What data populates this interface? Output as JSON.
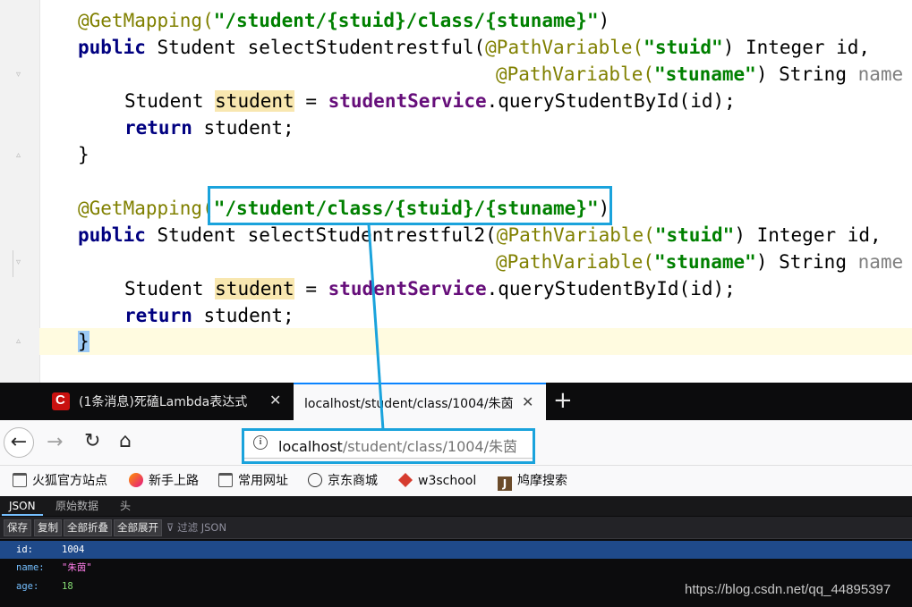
{
  "ide": {
    "l1": {
      "ann": "@GetMapping(",
      "str": "\"/student/{stuid}/class/{stuname}\"",
      "end": ")"
    },
    "l2": {
      "kw": "public",
      "mid": " Student selectStudentrestful(",
      "ann": "@PathVariable(",
      "str": "\"stuid\"",
      "end": ") Integer id,"
    },
    "l3": {
      "ann": "@PathVariable(",
      "str": "\"stuname\"",
      "end": ") String ",
      "par": "name"
    },
    "l4": {
      "type": "Student ",
      "var": "student",
      "eq": " = ",
      "fld": "studentService",
      "end": ".queryStudentById(id);"
    },
    "l5": {
      "kw": "return",
      "end": " student;"
    },
    "l6": {
      "text": "}"
    },
    "l8": {
      "ann": "@GetMapping",
      "p1": "(",
      "str": "\"/student/class/{stuid}/{stuname}\"",
      "end": ")"
    },
    "l9": {
      "kw": "public",
      "mid": " Student selectStudentrestful2(",
      "ann": "@PathVariable(",
      "str": "\"stuid\"",
      "end": ") Integer id,"
    },
    "l10": {
      "ann": "@PathVariable(",
      "str": "\"stuname\"",
      "end": ") String ",
      "par": "name"
    },
    "l11": {
      "type": "Student ",
      "var": "student",
      "eq": " = ",
      "fld": "studentService",
      "end": ".queryStudentById(id);"
    },
    "l12": {
      "kw": "return",
      "end": " student;"
    },
    "l13": {
      "text": "}"
    }
  },
  "browser": {
    "tabs": [
      {
        "title": "(1条消息)死磕Lambda表达式",
        "icon": "csdn-icon"
      },
      {
        "title": "localhost/student/class/1004/朱茵",
        "icon": null
      }
    ],
    "close_glyph": "✕",
    "new_tab_glyph": "+",
    "nav": {
      "back": "←",
      "forward": "→",
      "reload": "↻",
      "home": "⌂"
    },
    "url": {
      "host": "localhost",
      "path": "/student/class/1004/朱茵"
    },
    "bookmarks": [
      {
        "label": "火狐官方站点",
        "icon": "folder-icon"
      },
      {
        "label": "新手上路",
        "icon": "firefox-icon"
      },
      {
        "label": "常用网址",
        "icon": "folder-icon"
      },
      {
        "label": "京东商城",
        "icon": "globe-icon"
      },
      {
        "label": "w3school",
        "icon": "w3school-icon"
      },
      {
        "label": "鸠摩搜索",
        "icon": "jiumo-icon"
      }
    ]
  },
  "json_viewer": {
    "tabs": [
      "JSON",
      "原始数据",
      "头"
    ],
    "buttons": [
      "保存",
      "复制",
      "全部折叠",
      "全部展开"
    ],
    "filter_placeholder": "过滤 JSON",
    "rows": [
      {
        "key": "id:",
        "value": "1004"
      },
      {
        "key": "name:",
        "value": "\"朱茵\""
      },
      {
        "key": "age:",
        "value": "18"
      }
    ]
  },
  "watermark": "https://blog.csdn.net/qq_44895397",
  "colors": {
    "highlight": "#1aa3dc",
    "annotation": "#808000",
    "keyword": "#000080",
    "string": "#008000"
  }
}
